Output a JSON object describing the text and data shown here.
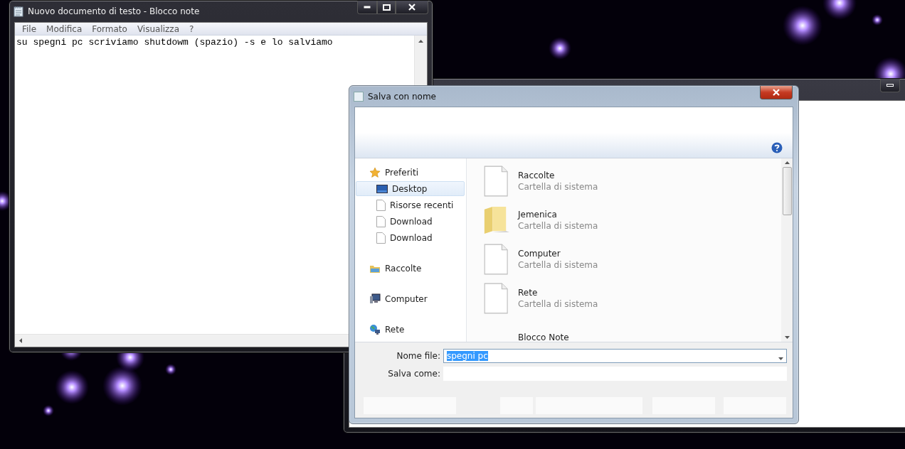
{
  "notepad": {
    "title": "Nuovo documento di testo - Blocco note",
    "menu": [
      "File",
      "Modifica",
      "Formato",
      "Visualizza",
      "?"
    ],
    "text": "su spegni pc scriviamo shutdowm (spazio) -s e lo salviamo"
  },
  "dialog": {
    "title": "Salva con nome",
    "nav": [
      {
        "label": "Preferiti",
        "kind": "star",
        "selected": false,
        "children": [
          {
            "label": "Desktop",
            "kind": "desktop",
            "selected": true
          },
          {
            "label": "Risorse recenti",
            "kind": "page",
            "selected": false
          },
          {
            "label": "Download",
            "kind": "page",
            "selected": false
          },
          {
            "label": "Download",
            "kind": "page",
            "selected": false
          }
        ]
      },
      {
        "label": "Raccolte",
        "kind": "library",
        "selected": false
      },
      {
        "label": "Computer",
        "kind": "computer",
        "selected": false
      },
      {
        "label": "Rete",
        "kind": "network",
        "selected": false
      }
    ],
    "items": [
      {
        "name": "Raccolte",
        "type": "Cartella di sistema",
        "kind": "page"
      },
      {
        "name": "Jemenica",
        "type": "Cartella di sistema",
        "kind": "folder"
      },
      {
        "name": "Computer",
        "type": "Cartella di sistema",
        "kind": "page"
      },
      {
        "name": "Rete",
        "type": "Cartella di sistema",
        "kind": "page"
      },
      {
        "name": "Blocco Note",
        "kind": "none"
      }
    ],
    "filename": {
      "label": "Nome file:",
      "value": "spegni pc"
    },
    "savetype": {
      "label": "Salva come:"
    }
  }
}
